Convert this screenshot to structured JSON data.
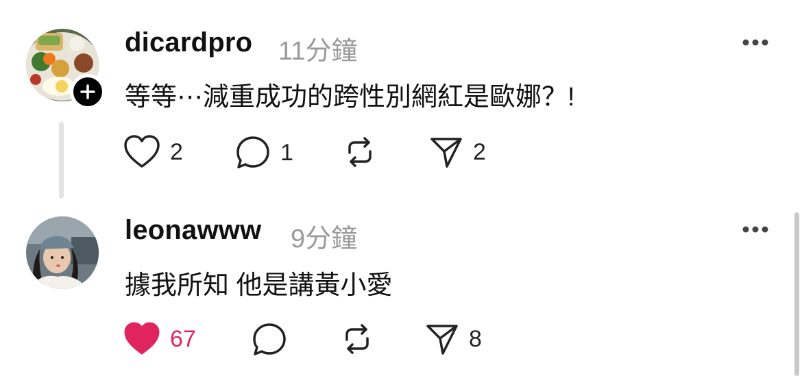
{
  "comments": [
    {
      "username": "dicardpro",
      "time": "11分鐘",
      "text": "等等⋯減重成功的跨性別網紅是歐娜？!",
      "likes": "2",
      "replies": "1",
      "reposts": "",
      "shares": "2",
      "liked": false,
      "avatar": "food-plate-avatar",
      "has_follow_badge": true
    },
    {
      "username": "leonawww",
      "time": "9分鐘",
      "text": "據我所知 他是講黃小愛",
      "likes": "67",
      "replies": "",
      "reposts": "",
      "shares": "8",
      "liked": true,
      "avatar": "person-cap-avatar",
      "has_follow_badge": false
    }
  ],
  "colors": {
    "like_active": "#e0245e",
    "muted": "#9a9a9a",
    "icon": "#222222"
  },
  "icons": [
    "heart-icon",
    "comment-icon",
    "repost-icon",
    "share-icon",
    "more-icon",
    "plus-icon"
  ]
}
